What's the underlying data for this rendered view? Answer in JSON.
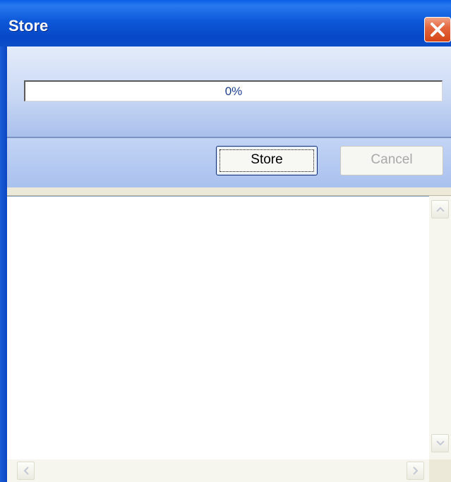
{
  "window": {
    "title": "Store"
  },
  "progress": {
    "value": 0,
    "label": "0%"
  },
  "buttons": {
    "store_label": "Store",
    "cancel_label": "Cancel"
  },
  "content": {
    "text": ""
  },
  "icons": {
    "close": "close-icon",
    "scroll_up": "chevron-up-icon",
    "scroll_down": "chevron-down-icon",
    "scroll_left": "chevron-left-icon",
    "scroll_right": "chevron-right-icon"
  },
  "colors": {
    "titlebar": "#0a4ec8",
    "close_button": "#e5683f",
    "panel_light": "#e4ecfa",
    "panel_dark": "#a9c0ec",
    "progress_text": "#1f3f8f"
  }
}
